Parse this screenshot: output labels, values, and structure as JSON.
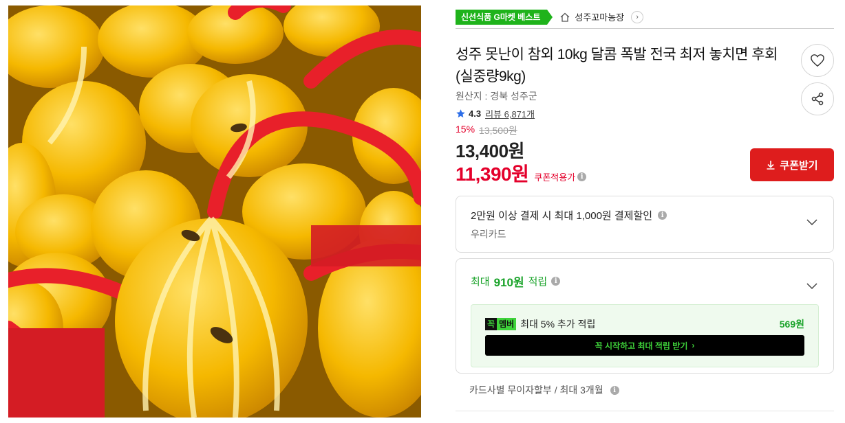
{
  "product": {
    "image_alt": "성주 참외",
    "badge": "신선식품 G마켓 베스트",
    "shop_name": "성주꼬마농장",
    "shop_chevron": "›",
    "title": "성주 못난이 참외 10kg 달콤 폭발 전국 최저 놓치면 후회 (실중량9kg)",
    "origin": "원산지 : 경북 성주군",
    "rating": "4.3",
    "review_label": "리뷰 6,871개",
    "discount_rate": "15%",
    "original_price": "13,500원",
    "price": "13,400원",
    "coupon_price": "11,390원",
    "coupon_note": "쿠폰적용가",
    "coupon_button": "쿠폰받기"
  },
  "card_benefit": {
    "title": "2만원 이상 결제 시 최대 1,000원 결제할인",
    "card": "우리카드"
  },
  "points": {
    "prefix": "최대",
    "amount": "910원",
    "suffix": "적립",
    "member_logo_a": "꼭",
    "member_logo_b": "멤버",
    "member_text": "최대 5% 추가 적립",
    "member_amount": "569원",
    "cta": "꼭 시작하고 최대 적립 받기",
    "cta_arrow": "›"
  },
  "installment": "카드사별 무이자할부 / 최대 3개월",
  "info_glyph": "i",
  "icons": {
    "favorite": "heart-icon",
    "share": "share-icon",
    "home": "home-icon",
    "star": "star-icon",
    "download": "download-icon",
    "chevron": "chevron-down-icon"
  },
  "colors": {
    "badge_green": "#1fb31b",
    "sale_red": "#e4002b",
    "coupon_button": "#de1d1d",
    "points_green": "#1aa32a",
    "member_bg": "#effaee",
    "rating_star": "#2d6ee8"
  }
}
